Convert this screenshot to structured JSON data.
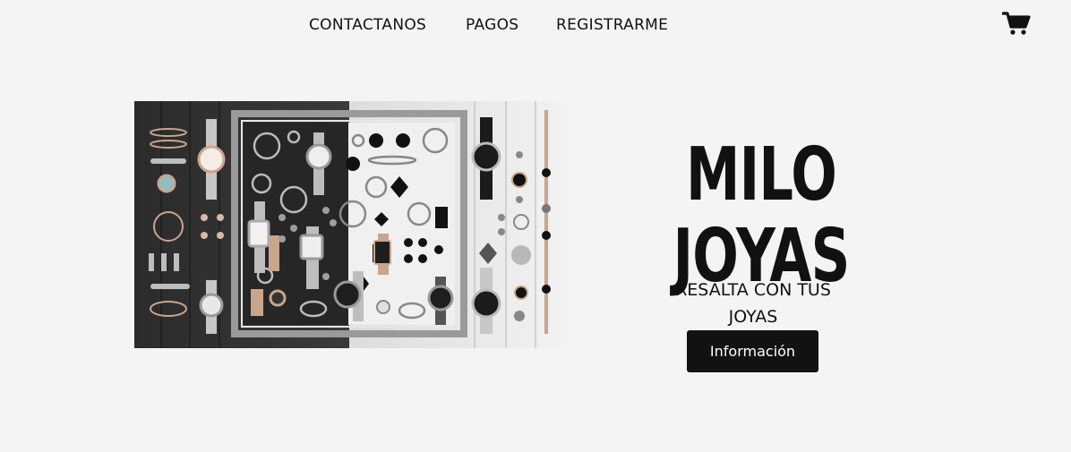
{
  "nav": {
    "items": [
      "CONTACTANOS",
      "PAGOS",
      "REGISTRARME"
    ]
  },
  "cart": {
    "icon": "cart-icon"
  },
  "hero": {
    "title_line1": "MILO",
    "title_line2": "JOYAS",
    "tagline": "RESALTA CON TUS JOYAS",
    "button_label": "Información"
  },
  "colors": {
    "background": "#f4f4f4",
    "text": "#111111",
    "button": "#121212"
  }
}
